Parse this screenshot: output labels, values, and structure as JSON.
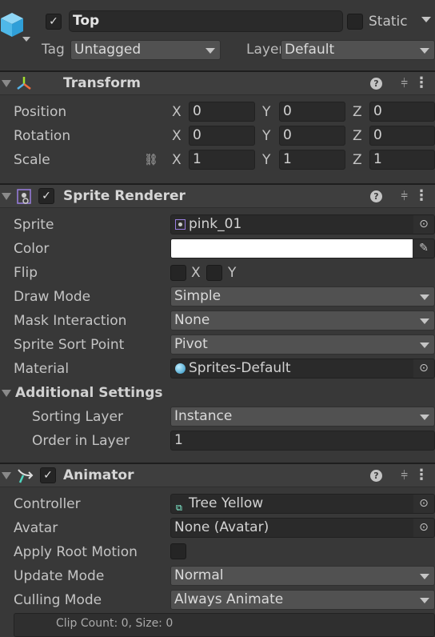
{
  "header": {
    "active": true,
    "name": "Top",
    "static_label": "Static",
    "static": false,
    "tag_label": "Tag",
    "tag": "Untagged",
    "layer_label": "Layer",
    "layer": "Default"
  },
  "transform": {
    "title": "Transform",
    "rows": [
      {
        "label": "Position",
        "x": "0",
        "y": "0",
        "z": "0"
      },
      {
        "label": "Rotation",
        "x": "0",
        "y": "0",
        "z": "0"
      },
      {
        "label": "Scale",
        "x": "1",
        "y": "1",
        "z": "1"
      }
    ],
    "axes": [
      "X",
      "Y",
      "Z"
    ]
  },
  "sprite_renderer": {
    "title": "Sprite Renderer",
    "enabled": true,
    "sprite_label": "Sprite",
    "sprite": "pink_01",
    "color_label": "Color",
    "color": "#ffffff",
    "flip_label": "Flip",
    "flip_x": "X",
    "flip_y": "Y",
    "draw_mode_label": "Draw Mode",
    "draw_mode": "Simple",
    "mask_label": "Mask Interaction",
    "mask": "None",
    "sort_point_label": "Sprite Sort Point",
    "sort_point": "Pivot",
    "material_label": "Material",
    "material": "Sprites-Default",
    "additional_label": "Additional Settings",
    "sorting_layer_label": "Sorting Layer",
    "sorting_layer": "Instance",
    "order_label": "Order in Layer",
    "order": "1"
  },
  "animator": {
    "title": "Animator",
    "enabled": true,
    "controller_label": "Controller",
    "controller": "Tree Yellow",
    "avatar_label": "Avatar",
    "avatar": "None (Avatar)",
    "root_motion_label": "Apply Root Motion",
    "root_motion": false,
    "update_label": "Update Mode",
    "update": "Normal",
    "culling_label": "Culling Mode",
    "culling": "Always Animate",
    "info": "Clip Count: 0, Size: 0"
  }
}
